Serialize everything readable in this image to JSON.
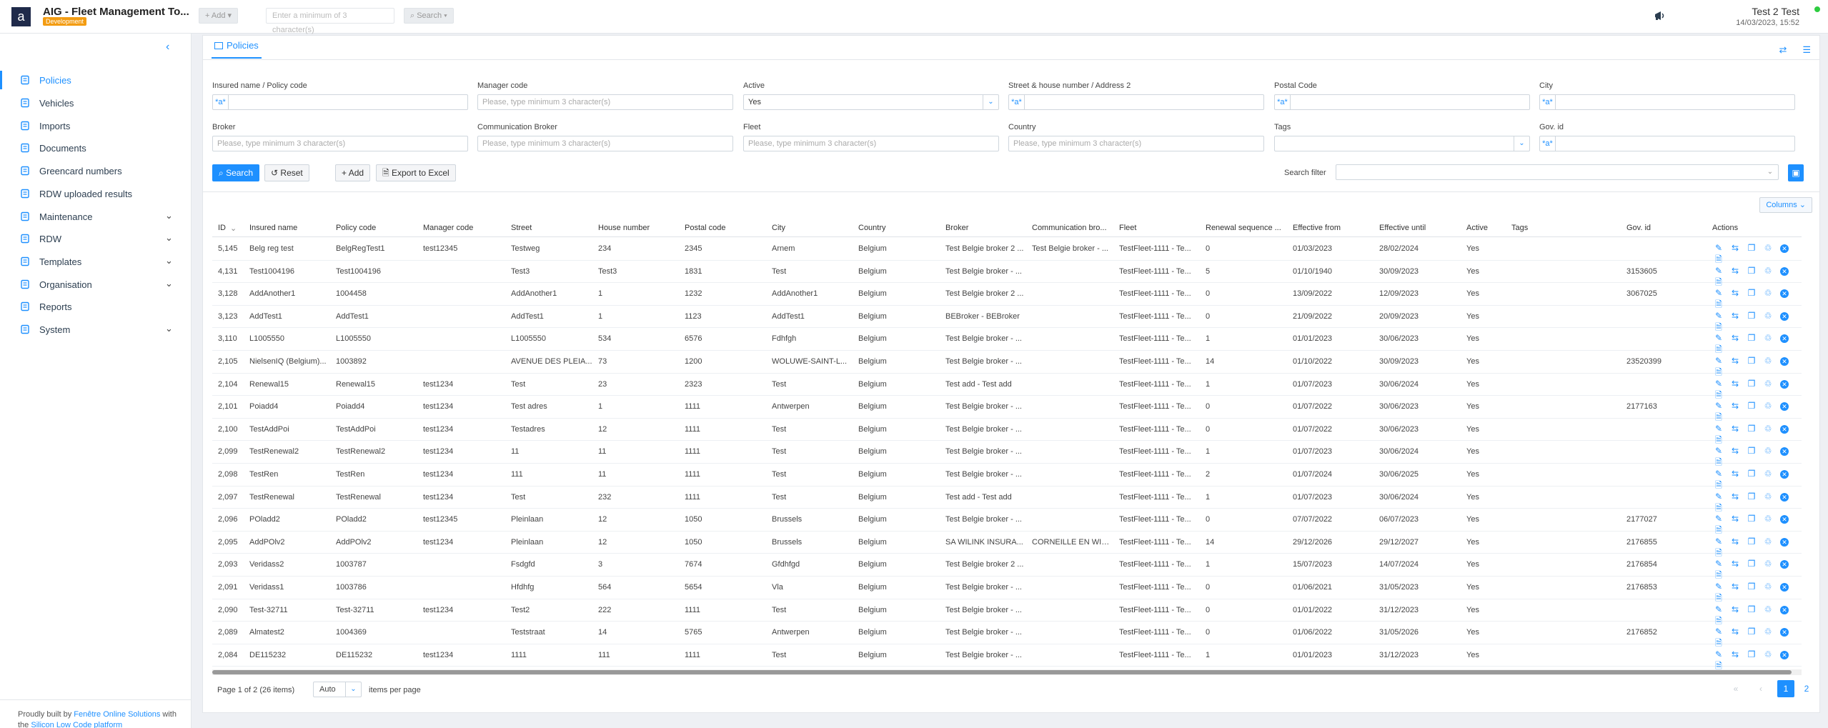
{
  "header": {
    "logo_letter": "a",
    "app_title": "AIG - Fleet Management To...",
    "env_badge": "Development",
    "add_button": "+ Add",
    "search_placeholder": "Enter a minimum of 3 character(s)",
    "search_button": "Search",
    "user_name": "Test 2 Test",
    "user_datetime": "14/03/2023, 15:52"
  },
  "sidebar": {
    "items": [
      {
        "label": "Policies",
        "icon": "policies-icon",
        "active": true,
        "expandable": false
      },
      {
        "label": "Vehicles",
        "icon": "car-icon",
        "active": false,
        "expandable": false
      },
      {
        "label": "Imports",
        "icon": "import-icon",
        "active": false,
        "expandable": false
      },
      {
        "label": "Documents",
        "icon": "document-icon",
        "active": false,
        "expandable": false
      },
      {
        "label": "Greencard numbers",
        "icon": "card-icon",
        "active": false,
        "expandable": false
      },
      {
        "label": "RDW uploaded results",
        "icon": "upload-icon",
        "active": false,
        "expandable": false
      },
      {
        "label": "Maintenance",
        "icon": "wrench-icon",
        "active": false,
        "expandable": true
      },
      {
        "label": "RDW",
        "icon": "globe-icon",
        "active": false,
        "expandable": true
      },
      {
        "label": "Templates",
        "icon": "template-icon",
        "active": false,
        "expandable": true
      },
      {
        "label": "Organisation",
        "icon": "people-icon",
        "active": false,
        "expandable": true
      },
      {
        "label": "Reports",
        "icon": "report-icon",
        "active": false,
        "expandable": false
      },
      {
        "label": "System",
        "icon": "gear-icon",
        "active": false,
        "expandable": true
      }
    ],
    "footer_prefix": "Proudly built by ",
    "footer_link1": "Fenêtre Online Solutions",
    "footer_mid": " with the ",
    "footer_link2": "Silicon Low Code platform"
  },
  "tab": {
    "label": "Policies"
  },
  "filters": {
    "insured": {
      "label": "Insured name / Policy code",
      "prefix": "*a*",
      "value": ""
    },
    "manager": {
      "label": "Manager code",
      "placeholder": "Please, type minimum 3 character(s)"
    },
    "active": {
      "label": "Active",
      "value": "Yes"
    },
    "street": {
      "label": "Street & house number / Address 2",
      "prefix": "*a*",
      "value": ""
    },
    "postal": {
      "label": "Postal Code",
      "prefix": "*a*",
      "value": ""
    },
    "city": {
      "label": "City",
      "prefix": "*a*",
      "value": ""
    },
    "broker": {
      "label": "Broker",
      "placeholder": "Please, type minimum 3 character(s)"
    },
    "comm_broker": {
      "label": "Communication Broker",
      "placeholder": "Please, type minimum 3 character(s)"
    },
    "fleet": {
      "label": "Fleet",
      "placeholder": "Please, type minimum 3 character(s)"
    },
    "country": {
      "label": "Country",
      "placeholder": "Please, type minimum 3 character(s)"
    },
    "tags": {
      "label": "Tags",
      "value": ""
    },
    "gov_id": {
      "label": "Gov. id",
      "prefix": "*a*",
      "value": ""
    },
    "search_btn": "Search",
    "reset_btn": "Reset",
    "add_btn": "Add",
    "export_btn": "Export to Excel",
    "search_filter_label": "Search filter"
  },
  "columns_btn": "Columns",
  "table": {
    "headers": [
      "ID",
      "Insured name",
      "Policy code",
      "Manager code",
      "Street",
      "House number",
      "Postal code",
      "City",
      "Country",
      "Broker",
      "Communication bro...",
      "Fleet",
      "Renewal sequence ...",
      "Effective from",
      "Effective until",
      "Active",
      "Tags",
      "Gov. id",
      "Actions"
    ],
    "rows": [
      [
        "5,145",
        "Belg reg test",
        "BelgRegTest1",
        "test12345",
        "Testweg",
        "234",
        "2345",
        "Arnem",
        "Belgium",
        "Test Belgie broker 2 ...",
        "Test Belgie broker - ...",
        "TestFleet-1111 - Te...",
        "0",
        "01/03/2023",
        "28/02/2024",
        "Yes",
        "",
        ""
      ],
      [
        "4,131",
        "Test1004196",
        "Test1004196",
        "",
        "Test3",
        "Test3",
        "1831",
        "Test",
        "Belgium",
        "Test Belgie broker - ...",
        "",
        "TestFleet-1111 - Te...",
        "5",
        "01/10/1940",
        "30/09/2023",
        "Yes",
        "",
        "3153605"
      ],
      [
        "3,128",
        "AddAnother1",
        "1004458",
        "",
        "AddAnother1",
        "1",
        "1232",
        "AddAnother1",
        "Belgium",
        "Test Belgie broker 2 ...",
        "",
        "TestFleet-1111 - Te...",
        "0",
        "13/09/2022",
        "12/09/2023",
        "Yes",
        "",
        "3067025"
      ],
      [
        "3,123",
        "AddTest1",
        "AddTest1",
        "",
        "AddTest1",
        "1",
        "1123",
        "AddTest1",
        "Belgium",
        "BEBroker - BEBroker",
        "",
        "TestFleet-1111 - Te...",
        "0",
        "21/09/2022",
        "20/09/2023",
        "Yes",
        "",
        ""
      ],
      [
        "3,110",
        "L1005550",
        "L1005550",
        "",
        "L1005550",
        "534",
        "6576",
        "Fdhfgh",
        "Belgium",
        "Test Belgie broker - ...",
        "",
        "TestFleet-1111 - Te...",
        "1",
        "01/01/2023",
        "30/06/2023",
        "Yes",
        "",
        ""
      ],
      [
        "2,105",
        "NielsenIQ (Belgium)...",
        "1003892",
        "",
        "AVENUE DES PLEIA...",
        "73",
        "1200",
        "WOLUWE-SAINT-L...",
        "Belgium",
        "Test Belgie broker - ...",
        "",
        "TestFleet-1111 - Te...",
        "14",
        "01/10/2022",
        "30/09/2023",
        "Yes",
        "",
        "23520399"
      ],
      [
        "2,104",
        "Renewal15",
        "Renewal15",
        "test1234",
        "Test",
        "23",
        "2323",
        "Test",
        "Belgium",
        "Test add - Test add",
        "",
        "TestFleet-1111 - Te...",
        "1",
        "01/07/2023",
        "30/06/2024",
        "Yes",
        "",
        ""
      ],
      [
        "2,101",
        "Poiadd4",
        "Poiadd4",
        "test1234",
        "Test adres",
        "1",
        "1111",
        "Antwerpen",
        "Belgium",
        "Test Belgie broker - ...",
        "",
        "TestFleet-1111 - Te...",
        "0",
        "01/07/2022",
        "30/06/2023",
        "Yes",
        "",
        "2177163"
      ],
      [
        "2,100",
        "TestAddPoi",
        "TestAddPoi",
        "test1234",
        "Testadres",
        "12",
        "1111",
        "Test",
        "Belgium",
        "Test Belgie broker - ...",
        "",
        "TestFleet-1111 - Te...",
        "0",
        "01/07/2022",
        "30/06/2023",
        "Yes",
        "",
        ""
      ],
      [
        "2,099",
        "TestRenewal2",
        "TestRenewal2",
        "test1234",
        "11",
        "11",
        "1111",
        "Test",
        "Belgium",
        "Test Belgie broker - ...",
        "",
        "TestFleet-1111 - Te...",
        "1",
        "01/07/2023",
        "30/06/2024",
        "Yes",
        "",
        ""
      ],
      [
        "2,098",
        "TestRen",
        "TestRen",
        "test1234",
        "111",
        "11",
        "1111",
        "Test",
        "Belgium",
        "Test Belgie broker - ...",
        "",
        "TestFleet-1111 - Te...",
        "2",
        "01/07/2024",
        "30/06/2025",
        "Yes",
        "",
        ""
      ],
      [
        "2,097",
        "TestRenewal",
        "TestRenewal",
        "test1234",
        "Test",
        "232",
        "1111",
        "Test",
        "Belgium",
        "Test add - Test add",
        "",
        "TestFleet-1111 - Te...",
        "1",
        "01/07/2023",
        "30/06/2024",
        "Yes",
        "",
        ""
      ],
      [
        "2,096",
        "POladd2",
        "POladd2",
        "test12345",
        "Pleinlaan",
        "12",
        "1050",
        "Brussels",
        "Belgium",
        "Test Belgie broker - ...",
        "",
        "TestFleet-1111 - Te...",
        "0",
        "07/07/2022",
        "06/07/2023",
        "Yes",
        "",
        "2177027"
      ],
      [
        "2,095",
        "AddPOlv2",
        "AddPOlv2",
        "test1234",
        "Pleinlaan",
        "12",
        "1050",
        "Brussels",
        "Belgium",
        "SA WILINK INSURA...",
        "CORNEILLE EN WIL...",
        "TestFleet-1111 - Te...",
        "14",
        "29/12/2026",
        "29/12/2027",
        "Yes",
        "",
        "2176855"
      ],
      [
        "2,093",
        "Veridass2",
        "1003787",
        "",
        "Fsdgfd",
        "3",
        "7674",
        "Gfdhfgd",
        "Belgium",
        "Test Belgie broker 2 ...",
        "",
        "TestFleet-1111 - Te...",
        "1",
        "15/07/2023",
        "14/07/2024",
        "Yes",
        "",
        "2176854"
      ],
      [
        "2,091",
        "Veridass1",
        "1003786",
        "",
        "Hfdhfg",
        "564",
        "5654",
        "Vla",
        "Belgium",
        "Test Belgie broker - ...",
        "",
        "TestFleet-1111 - Te...",
        "0",
        "01/06/2021",
        "31/05/2023",
        "Yes",
        "",
        "2176853"
      ],
      [
        "2,090",
        "Test-32711",
        "Test-32711",
        "test1234",
        "Test2",
        "222",
        "1111",
        "Test",
        "Belgium",
        "Test Belgie broker - ...",
        "",
        "TestFleet-1111 - Te...",
        "0",
        "01/01/2022",
        "31/12/2023",
        "Yes",
        "",
        ""
      ],
      [
        "2,089",
        "Almatest2",
        "1004369",
        "",
        "Teststraat",
        "14",
        "5765",
        "Antwerpen",
        "Belgium",
        "Test Belgie broker - ...",
        "",
        "TestFleet-1111 - Te...",
        "0",
        "01/06/2022",
        "31/05/2026",
        "Yes",
        "",
        "2176852"
      ],
      [
        "2,084",
        "DE115232",
        "DE115232",
        "test1234",
        "1111",
        "111",
        "1111",
        "Test",
        "Belgium",
        "Test Belgie broker - ...",
        "",
        "TestFleet-1111 - Te...",
        "1",
        "01/01/2023",
        "31/12/2023",
        "Yes",
        "",
        ""
      ]
    ]
  },
  "pager": {
    "info": "Page 1 of 2 (26 items)",
    "per_page_value": "Auto",
    "per_page_label": "items per page",
    "pages": [
      "1",
      "2"
    ],
    "current_page": "1"
  },
  "colors": {
    "accent": "#1e90ff",
    "badge": "#f39c12",
    "online": "#2ecc40"
  }
}
